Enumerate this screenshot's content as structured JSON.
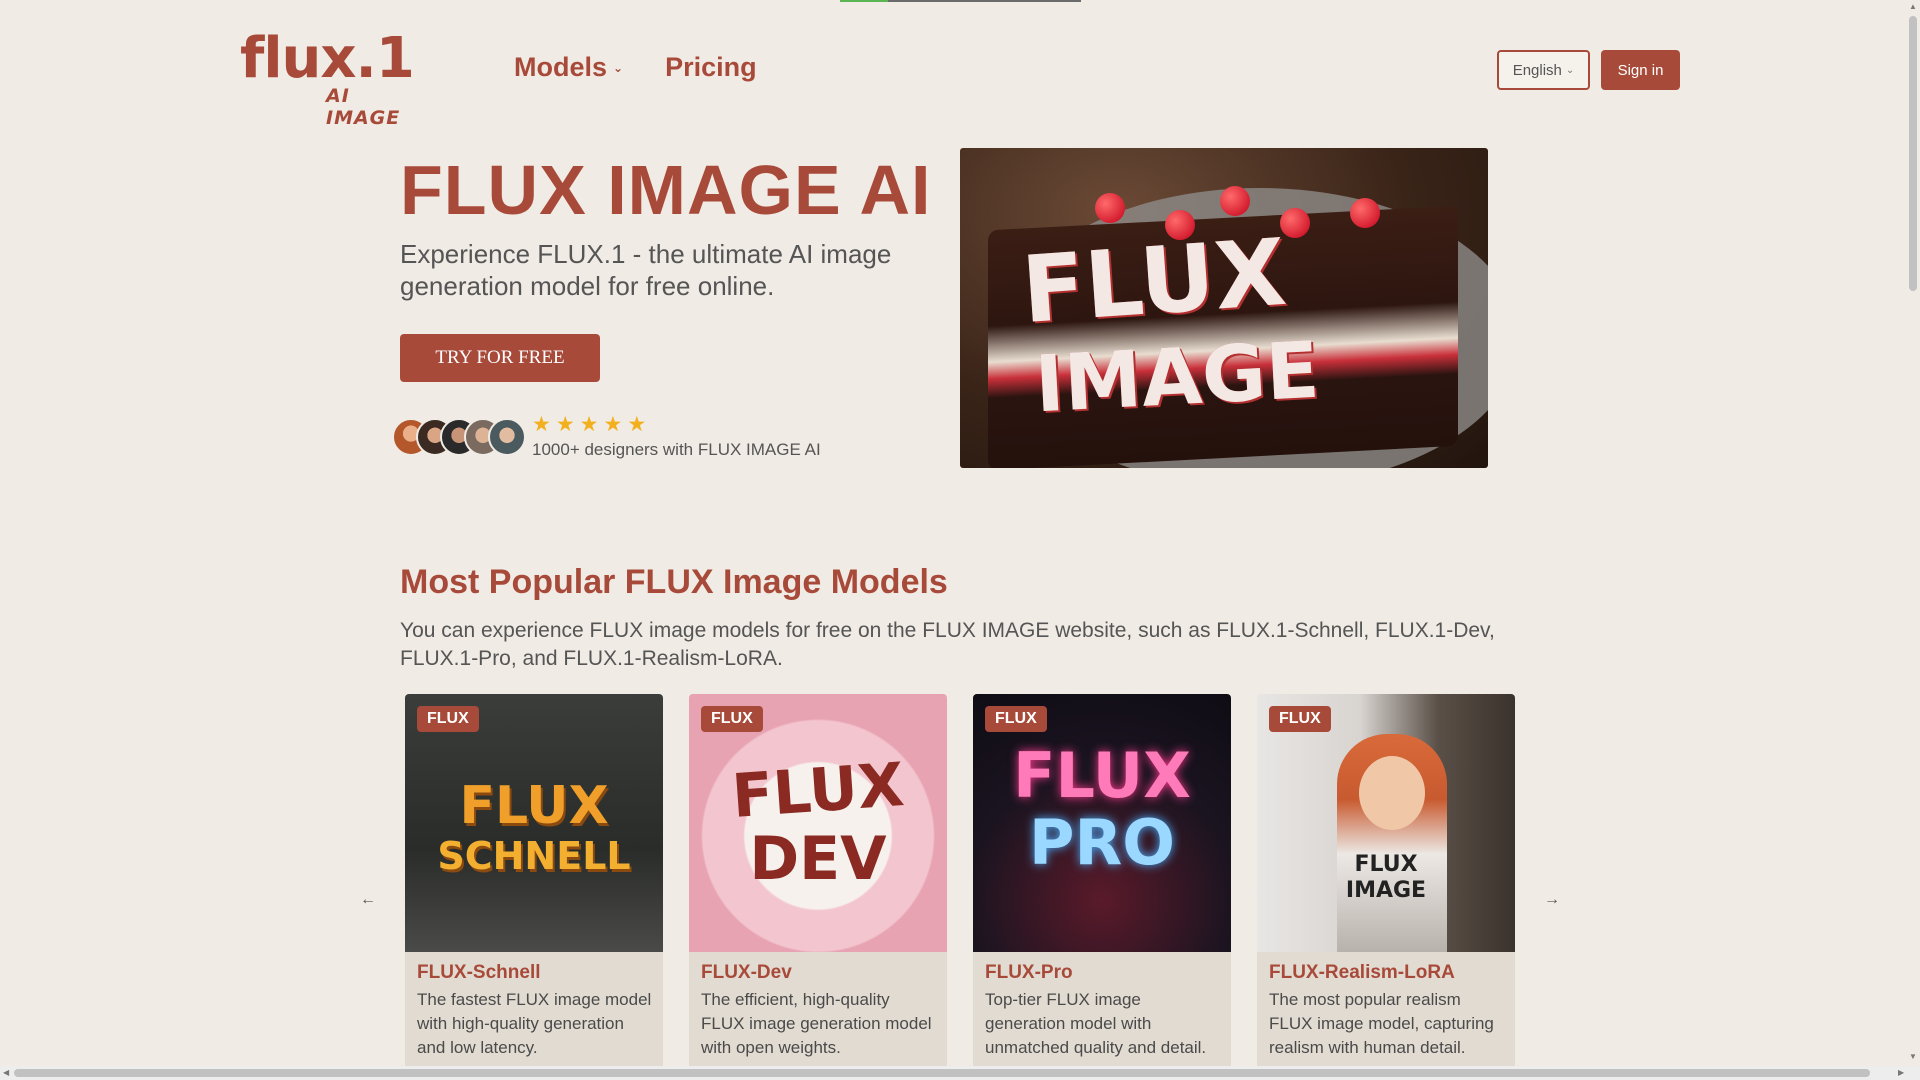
{
  "header": {
    "logo_main": "flux.1",
    "logo_sub": "AI IMAGE",
    "nav": [
      {
        "label": "Models",
        "has_dropdown": true
      },
      {
        "label": "Pricing",
        "has_dropdown": false
      }
    ],
    "language": "English",
    "signin_label": "Sign in"
  },
  "hero": {
    "title": "FLUX IMAGE AI",
    "subtitle": "Experience FLUX.1 - the ultimate AI image generation model for free online.",
    "cta_label": "TRY FOR FREE",
    "rating_stars": 5,
    "social_text": "1000+ designers with FLUX IMAGE AI",
    "image_text_top": "FLUX",
    "image_text_bottom": "IMAGE"
  },
  "models_section": {
    "title": "Most Popular FLUX Image Models",
    "description": "You can experience FLUX image models for free on the FLUX IMAGE website, such as FLUX.1-Schnell, FLUX.1-Dev, FLUX.1-Pro, and FLUX.1-Realism-LoRA.",
    "cards": [
      {
        "badge": "FLUX",
        "title": "FLUX-Schnell",
        "description": "The fastest FLUX image model with high-quality generation and low latency.",
        "image_text": [
          "FLUX",
          "SCHNELL"
        ]
      },
      {
        "badge": "FLUX",
        "title": "FLUX-Dev",
        "description": "The efficient, high-quality FLUX image generation model with open weights.",
        "image_text": [
          "FLUX",
          "DEV"
        ]
      },
      {
        "badge": "FLUX",
        "title": "FLUX-Pro",
        "description": "Top-tier FLUX image generation model with unmatched quality and detail.",
        "image_text": [
          "FLUX",
          "PRO"
        ]
      },
      {
        "badge": "FLUX",
        "title": "FLUX-Realism-LoRA",
        "description": "The most popular realism FLUX image model, capturing realism with human detail.",
        "image_text": [
          "FLUX",
          "IMAGE"
        ]
      }
    ]
  },
  "colors": {
    "brand": "#a84a3a",
    "background": "#f0ebe4",
    "star": "#f2b01e"
  },
  "icons": {
    "prev": "arrow-left-icon",
    "next": "arrow-right-icon",
    "dropdown": "chevron-down-icon",
    "star": "star-icon"
  }
}
